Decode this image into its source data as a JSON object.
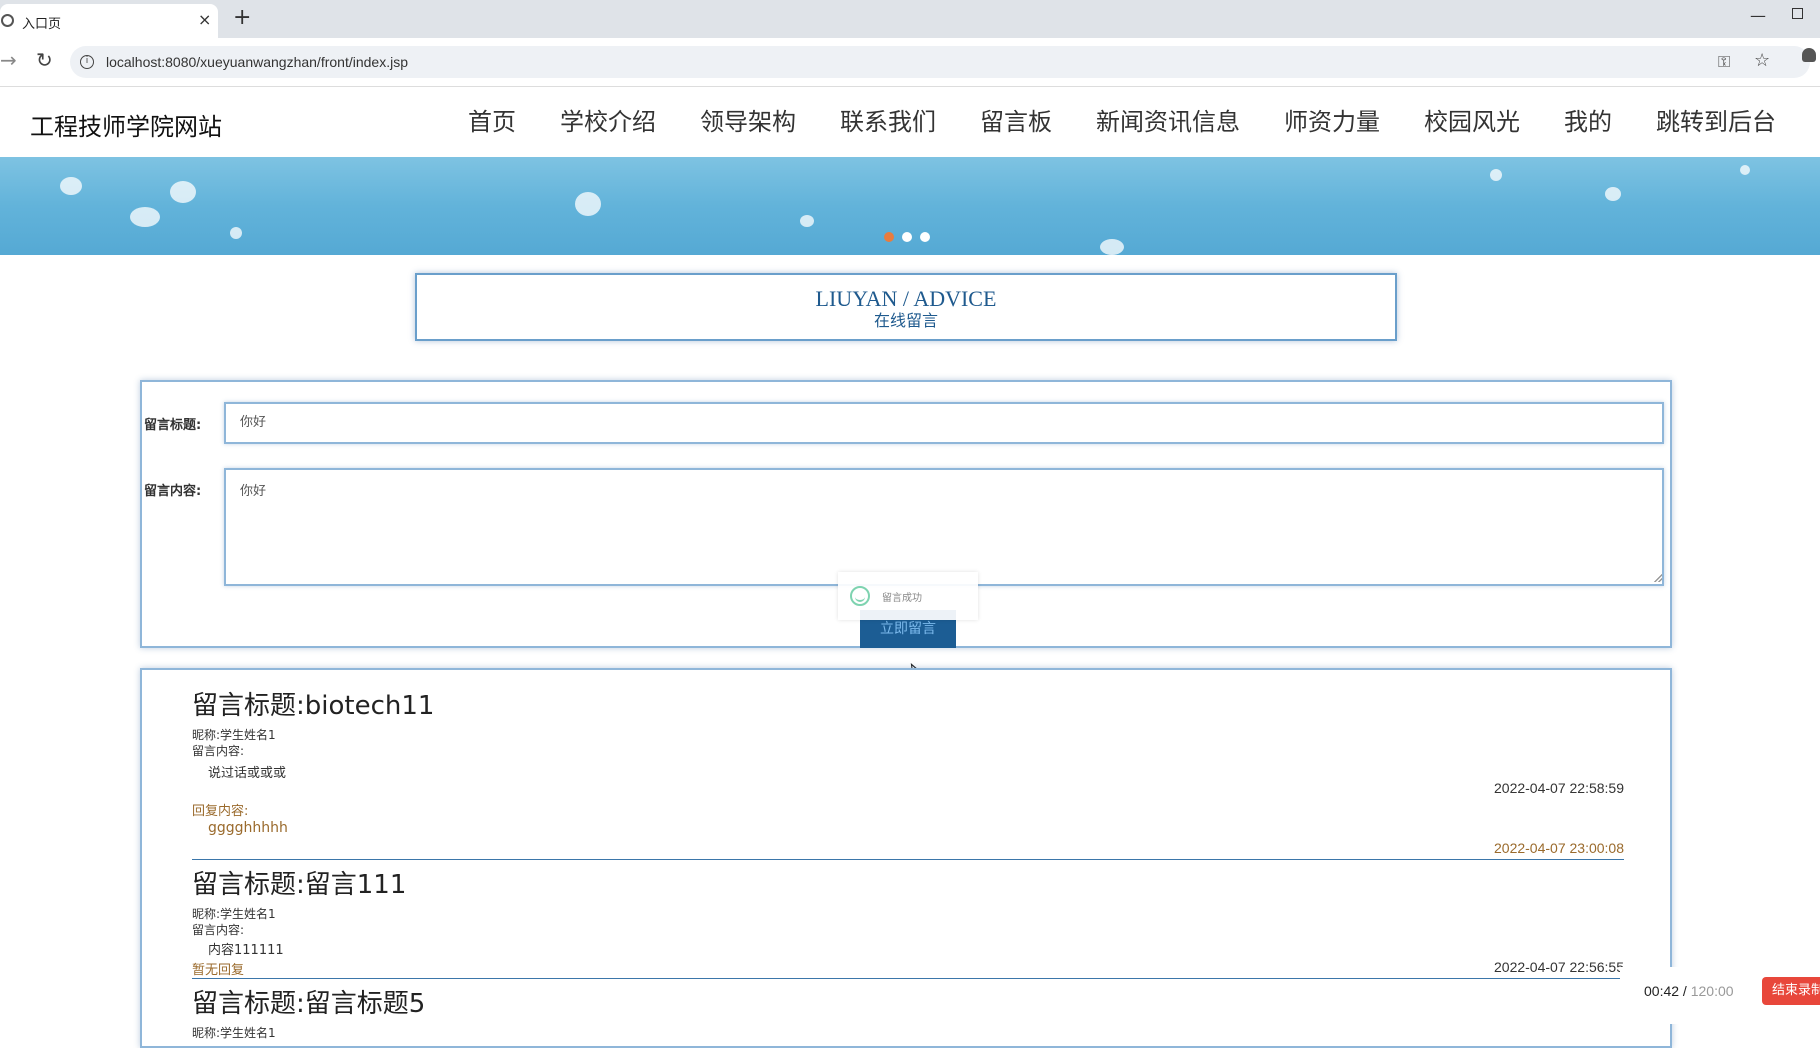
{
  "browser": {
    "tab_title": "入口页",
    "tab_close": "×",
    "new_tab": "+",
    "url": "localhost:8080/xueyuanwangzhan/front/index.jsp"
  },
  "site": {
    "logo": "工程技师学院网站",
    "nav": [
      "首页",
      "学校介绍",
      "领导架构",
      "联系我们",
      "留言板",
      "新闻资讯信息",
      "师资力量",
      "校园风光",
      "我的",
      "跳转到后台"
    ]
  },
  "banner": {
    "slides": 3,
    "active_slide": 0,
    "active_color": "#e87c3e"
  },
  "section": {
    "title_en": "LIUYAN / ADVICE",
    "title_cn": "在线留言"
  },
  "form": {
    "title_label": "留言标题:",
    "title_value": "你好",
    "content_label": "留言内容:",
    "content_value": "你好",
    "submit_label": "立即留言",
    "toast_text": "留言成功"
  },
  "messages": [
    {
      "title": "留言标题:biotech11",
      "nickname": "昵称:学生姓名1",
      "content_label": "留言内容:",
      "content": "说过话或或或",
      "time": "2022-04-07 22:58:59",
      "reply_label": "回复内容:",
      "reply": "gggghhhhh",
      "reply_time": "2022-04-07 23:00:08"
    },
    {
      "title": "留言标题:留言111",
      "nickname": "昵称:学生姓名1",
      "content_label": "留言内容:",
      "content": "内容111111",
      "no_reply": "暂无回复",
      "time": "2022-04-07 22:56:55"
    },
    {
      "title": "留言标题:留言标题5",
      "nickname": "昵称:学生姓名1"
    }
  ],
  "recorder": {
    "elapsed": "00:42",
    "separator": " / ",
    "total": "120:00",
    "stop_label": "结束录制"
  },
  "colors": {
    "accent": "#1f5a8e",
    "reply": "#9a6a2c",
    "button": "#1c5d94",
    "record": "#e8473b"
  }
}
